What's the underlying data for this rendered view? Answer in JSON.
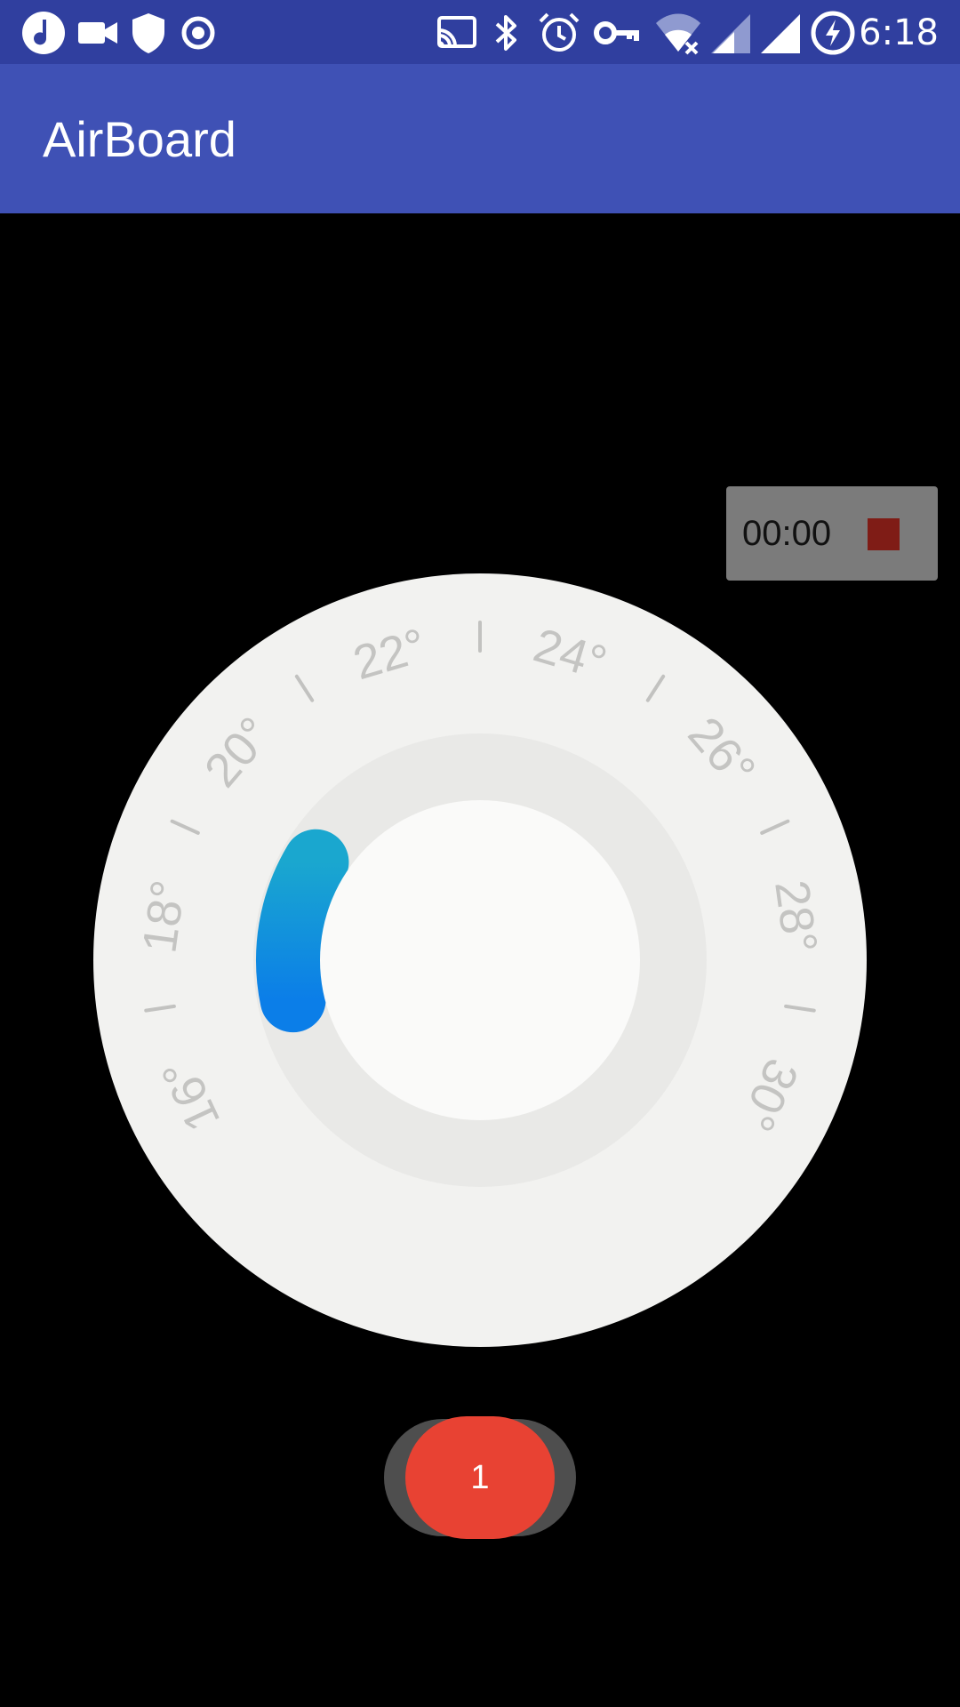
{
  "status_bar": {
    "time": "6:18",
    "icons_left": [
      "music-note-icon",
      "video-camera-icon",
      "shield-icon",
      "record-icon"
    ],
    "icons_right": [
      "cast-icon",
      "bluetooth-icon",
      "alarm-clock-icon",
      "vpn-key-icon",
      "wifi-off-icon",
      "cell-signal-icon",
      "cell-signal-full-icon",
      "battery-charging-icon"
    ]
  },
  "app_bar": {
    "title": "AirBoard"
  },
  "timer": {
    "time": "00:00"
  },
  "dial": {
    "tick_labels": [
      "16°",
      "18°",
      "20°",
      "22°",
      "24°",
      "26°",
      "28°",
      "30°"
    ],
    "range_min": 16,
    "range_max": 30,
    "selected_arc_start": 16.8,
    "selected_arc_end": 19.4
  },
  "toggle": {
    "label": "1"
  },
  "colors": {
    "status_bar": "#303F9F",
    "app_bar": "#3F51B5",
    "arc_start": "#1aa7cf",
    "arc_end": "#0b7ee8",
    "toggle": "#e84233",
    "stop": "#7f1c16"
  }
}
